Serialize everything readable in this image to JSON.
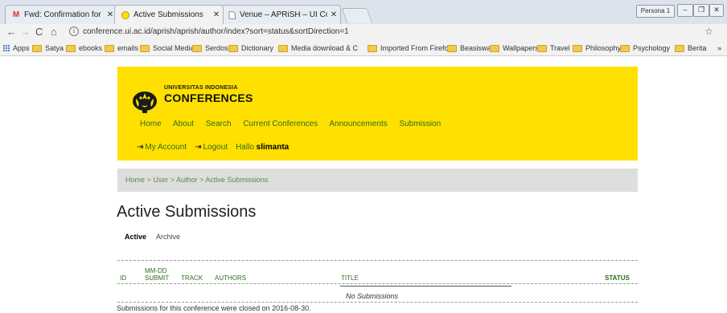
{
  "browser": {
    "tabs": [
      {
        "title": "Fwd: Confirmation for re",
        "favicon": "gmail-icon"
      },
      {
        "title": "Active Submissions",
        "favicon": "ui-conference-icon"
      },
      {
        "title": "Venue – APRiSH – UI Co",
        "favicon": "document-icon"
      }
    ],
    "profile_label": "Persona 1",
    "url": "conference.ui.ac.id/aprish/aprish/author/index?sort=status&sortDirection=1",
    "bookmarks": [
      {
        "label": "Apps",
        "icon": "apps-grid-icon"
      },
      {
        "label": "Satya",
        "icon": "folder-icon"
      },
      {
        "label": "ebooks",
        "icon": "folder-icon"
      },
      {
        "label": "emails",
        "icon": "folder-icon"
      },
      {
        "label": "Social Media",
        "icon": "folder-icon"
      },
      {
        "label": "Serdos",
        "icon": "folder-icon"
      },
      {
        "label": "Dictionary",
        "icon": "folder-icon"
      },
      {
        "label": "Media download & C",
        "icon": "folder-icon"
      },
      {
        "label": "Imported From Firefo",
        "icon": "folder-icon"
      },
      {
        "label": "Beasiswa",
        "icon": "folder-icon"
      },
      {
        "label": "Wallpapers",
        "icon": "folder-icon"
      },
      {
        "label": "Travel",
        "icon": "folder-icon"
      },
      {
        "label": "Philosophy",
        "icon": "folder-icon"
      },
      {
        "label": "Psychology",
        "icon": "folder-icon"
      },
      {
        "label": "Berita",
        "icon": "folder-icon"
      }
    ],
    "overflow_label": "»"
  },
  "site": {
    "logo_line1": "UNIVERSITAS INDONESIA",
    "logo_line2": "CONFERENCES",
    "nav": [
      "Home",
      "About",
      "Search",
      "Current Conferences",
      "Announcements",
      "Submission"
    ],
    "user_nav": {
      "my_account": "My Account",
      "logout": "Logout",
      "hallo_prefix": "Hallo",
      "username": "slimanta"
    },
    "header_color": "#ffe000",
    "link_color": "#2c6e1f"
  },
  "breadcrumb": [
    "Home",
    "User",
    "Author",
    "Active Submissions"
  ],
  "breadcrumb_sep": " > ",
  "page": {
    "title": "Active Submissions",
    "tabs": {
      "active": "Active",
      "archive": "Archive"
    },
    "table": {
      "headers": {
        "id": "ID",
        "mmdd": "MM-DD",
        "submit": "SUBMIT",
        "track": "TRACK",
        "authors": "AUTHORS",
        "title": "TITLE",
        "status": "STATUS"
      },
      "empty": "No Submissions"
    },
    "closed_notice": "Submissions for this conference were closed on 2016-08-30."
  }
}
